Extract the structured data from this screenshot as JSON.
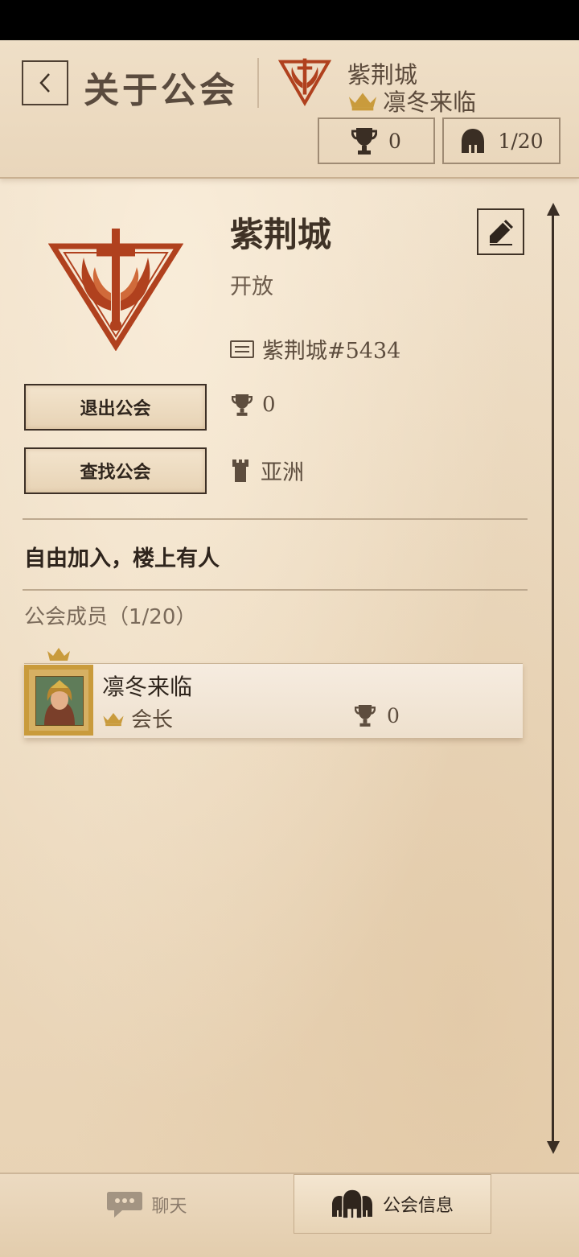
{
  "header": {
    "back_icon": "chevron-left-icon",
    "title": "关于公会",
    "guild_name": "紫荆城",
    "leader_name": "凛冬来临",
    "trophy_count": "0",
    "member_count": "1/20"
  },
  "guild": {
    "name": "紫荆城",
    "status": "开放",
    "id": "紫荆城#5434",
    "trophies": "0",
    "region": "亚洲",
    "description": "自由加入，楼上有人"
  },
  "actions": {
    "leave": "退出公会",
    "find": "查找公会"
  },
  "members": {
    "header": "公会成员（1/20）",
    "list": [
      {
        "name": "凛冬来临",
        "role": "会长",
        "trophies": "0"
      }
    ]
  },
  "nav": {
    "chat": "聊天",
    "guild_info": "公会信息"
  },
  "colors": {
    "accent": "#b0411e",
    "gold": "#c99b3c",
    "ink": "#3f3226"
  }
}
